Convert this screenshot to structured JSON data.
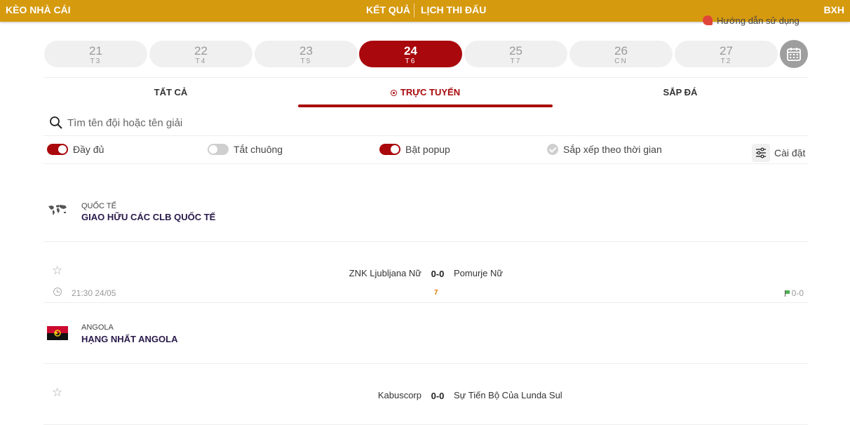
{
  "topbar": {
    "brand": "KÈO NHÀ CÁI",
    "result": "KẾT QUẢ",
    "schedule": "LỊCH THI ĐẤU",
    "standings": "BXH",
    "color": "#d69a0e"
  },
  "guide": {
    "label": "Hướng dẫn sử dụng"
  },
  "dates": [
    {
      "day": "21",
      "weekday": "T3"
    },
    {
      "day": "22",
      "weekday": "T4"
    },
    {
      "day": "23",
      "weekday": "T5"
    },
    {
      "day": "24",
      "weekday": "T6",
      "active": true
    },
    {
      "day": "25",
      "weekday": "T7"
    },
    {
      "day": "26",
      "weekday": "CN"
    },
    {
      "day": "27",
      "weekday": "T2"
    }
  ],
  "tabs": {
    "all": "TẤT CẢ",
    "live": "TRỰC TUYẾN",
    "upcoming": "SẮP ĐÁ",
    "active": "live"
  },
  "search": {
    "placeholder": "Tìm tên đội hoặc tên giải"
  },
  "options": {
    "full": {
      "label": "Đầy đủ",
      "on": true
    },
    "mute": {
      "label": "Tắt chuông",
      "on": false
    },
    "popup": {
      "label": "Bật popup",
      "on": true
    },
    "sort": {
      "label": "Sắp xếp theo thời gian"
    },
    "settings": {
      "label": "Cài đặt"
    }
  },
  "leagues": [
    {
      "country": "QUỐC TẾ",
      "name": "GIAO HỮU CÁC CLB QUỐC TẾ",
      "icon": "world-map-icon",
      "matches": [
        {
          "home": "ZNK Ljubljana Nữ",
          "score": "0-0",
          "away": "Pomurje Nữ",
          "time": "21:30 24/05",
          "minute": "7",
          "corners": "0-0"
        }
      ]
    },
    {
      "country": "ANGOLA",
      "name": "HẠNG NHẤT ANGOLA",
      "icon": "angola-flag-icon",
      "matches": [
        {
          "home": "Kabuscorp",
          "score": "0-0",
          "away": "Sự Tiến Bộ Của Lunda Sul"
        }
      ]
    }
  ],
  "colors": {
    "accent": "#a9080c",
    "gold": "#d69a0e"
  }
}
